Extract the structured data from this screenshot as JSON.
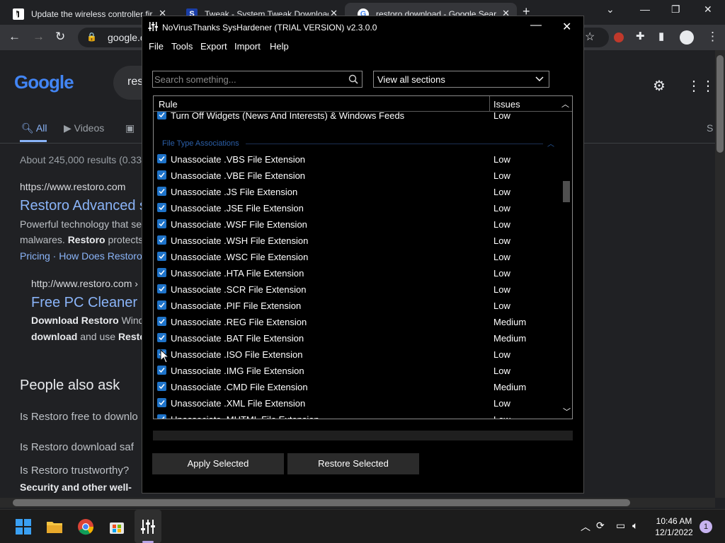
{
  "browser": {
    "tabs": [
      {
        "title": "Update the wireless controller fir",
        "icon": "playstation-icon",
        "active": false
      },
      {
        "title": "Tweak - System Tweak Download",
        "icon": "s-logo-icon",
        "active": false
      },
      {
        "title": "restoro download - Google Sear",
        "icon": "google-icon",
        "active": true
      }
    ],
    "address": "google.co",
    "new_tab": "+"
  },
  "google_page": {
    "logo_text": "Google",
    "query": "res",
    "tabs": [
      "All",
      "Videos"
    ],
    "tab_cut": "S",
    "results_count": "About 245,000 results (0.33",
    "result1_url": "https://www.restoro.com",
    "result1_title": "Restoro Advanced s",
    "result1_snippet1": "Powerful technology that se",
    "result1_snippet2a": "malwares.",
    "result1_snippet2b": "Restoro",
    "result1_snippet2c": "protects",
    "result1_links": "Pricing · How Does Restoro",
    "result2_url": "http://www.restoro.com ›",
    "result2_title": "Free PC Cleaner",
    "result2_snippet1a": "Download Restoro",
    "result2_snippet1b": "Windo",
    "result2_snippet2a": "download",
    "result2_snippet2b": "and use",
    "result2_snippet2c": "Resto",
    "people_also_ask": "People also ask",
    "paa": [
      "Is Restoro free to downlo",
      "Is Restoro download saf",
      "Is Restoro trustworthy?"
    ],
    "paa_bold": "Security and other well-"
  },
  "app": {
    "title": "NoVirusThanks SysHardener (TRIAL VERSION) v2.3.0.0",
    "menu": [
      "File",
      "Tools",
      "Export",
      "Import",
      "Help"
    ],
    "search_placeholder": "Search something...",
    "section_select": "View all sections",
    "columns": {
      "rule": "Rule",
      "issues": "Issues"
    },
    "top_row": {
      "name": "Turn Off Widgets (News And Interests) & Windows Feeds",
      "level": "Low"
    },
    "group": "File Type Associations",
    "rows": [
      {
        "name": "Unassociate .VBS File Extension",
        "level": "Low",
        "checked": true
      },
      {
        "name": "Unassociate .VBE File Extension",
        "level": "Low",
        "checked": true
      },
      {
        "name": "Unassociate .JS File Extension",
        "level": "Low",
        "checked": true
      },
      {
        "name": "Unassociate .JSE File Extension",
        "level": "Low",
        "checked": true
      },
      {
        "name": "Unassociate .WSF File Extension",
        "level": "Low",
        "checked": true
      },
      {
        "name": "Unassociate .WSH File Extension",
        "level": "Low",
        "checked": true
      },
      {
        "name": "Unassociate .WSC File Extension",
        "level": "Low",
        "checked": true
      },
      {
        "name": "Unassociate .HTA File Extension",
        "level": "Low",
        "checked": true
      },
      {
        "name": "Unassociate .SCR File Extension",
        "level": "Low",
        "checked": true
      },
      {
        "name": "Unassociate .PIF File Extension",
        "level": "Low",
        "checked": true
      },
      {
        "name": "Unassociate .REG File Extension",
        "level": "Medium",
        "checked": true
      },
      {
        "name": "Unassociate .BAT File Extension",
        "level": "Medium",
        "checked": true
      },
      {
        "name": "Unassociate .ISO File Extension",
        "level": "Low",
        "checked": true
      },
      {
        "name": "Unassociate .IMG File Extension",
        "level": "Low",
        "checked": true
      },
      {
        "name": "Unassociate .CMD File Extension",
        "level": "Medium",
        "checked": true
      },
      {
        "name": "Unassociate .XML File Extension",
        "level": "Low",
        "checked": true
      },
      {
        "name": "Unassociate .MHTML File Extension",
        "level": "Low",
        "checked": true
      }
    ],
    "apply_button": "Apply Selected",
    "restore_button": "Restore Selected",
    "colors": {
      "checkbox": "#1e73c9",
      "group_title": "#2b5fa8",
      "window_bg": "#000000"
    }
  },
  "taskbar": {
    "time": "10:46 AM",
    "date": "12/1/2022",
    "notifications": "1",
    "icons": [
      "windows-start-icon",
      "file-explorer-icon",
      "chrome-icon",
      "microsoft-store-icon",
      "syshardener-icon"
    ]
  }
}
